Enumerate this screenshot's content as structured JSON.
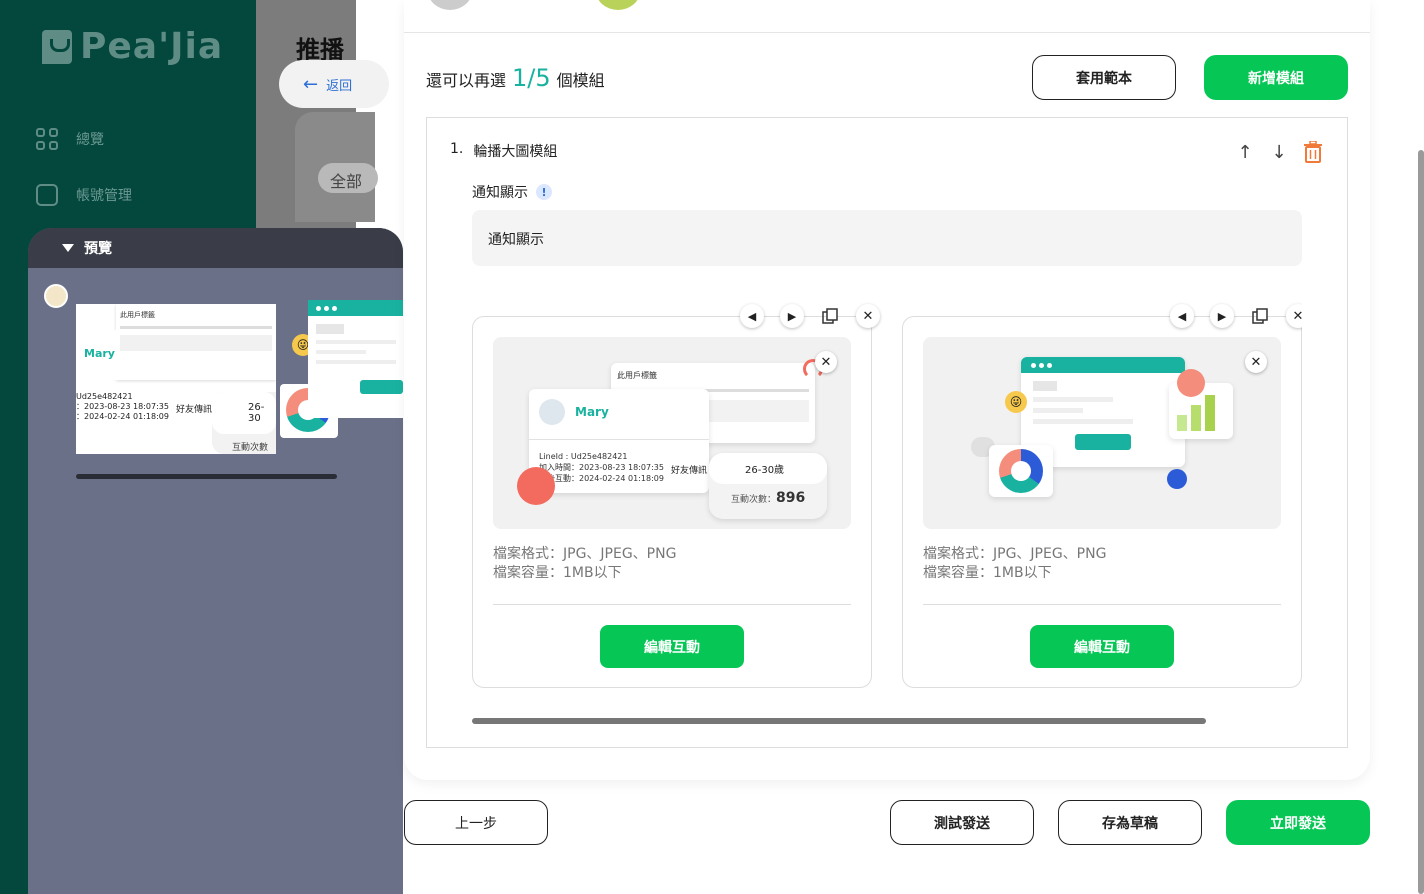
{
  "sidebar": {
    "brand": "Pea'Jia",
    "items": [
      {
        "label": "總覽",
        "icon": "grid-icon"
      },
      {
        "label": "帳號管理",
        "icon": "user-icon"
      }
    ]
  },
  "background_page": {
    "title": "推播",
    "back_label": "返回",
    "chip_label": "全部"
  },
  "preview": {
    "header_label": "預覽",
    "image": {
      "card_title": "此用戶標籤",
      "name": "Mary",
      "line_id": "Ud25e482421",
      "join_time": "：2023-08-23 18:07:35",
      "interact_time": "：2024-02-24 01:18:09",
      "friend_label": "好友傳訊",
      "age": "26-30",
      "interact_count_label": "互動次數"
    }
  },
  "editor": {
    "remain_prefix": "還可以再選",
    "remain_count": "1/5",
    "remain_suffix": "個模組",
    "apply_template_label": "套用範本",
    "add_module_label": "新增模組",
    "module": {
      "index": "1.",
      "title": "輪播大圖模組",
      "notify_label": "通知顯示",
      "notify_value": "通知顯示",
      "slides": [
        {
          "format": "檔案格式：JPG、JPEG、PNG",
          "size": "檔案容量：1MB以下",
          "edit_label": "編輯互動",
          "illustration": {
            "card_title": "此用戶標籤",
            "name": "Mary",
            "line_id": "LineId : Ud25e482421",
            "join_time": "加入時間：2023-08-23 18:07:35",
            "interact_time": "最後互動：2024-02-24 01:18:09",
            "friend_label": "好友傳訊",
            "age": "26-30歲",
            "interact_count_label": "互動次數：",
            "interact_count": "896"
          }
        },
        {
          "format": "檔案格式：JPG、JPEG、PNG",
          "size": "檔案容量：1MB以下",
          "edit_label": "編輯互動"
        }
      ]
    }
  },
  "footer": {
    "prev_label": "上一步",
    "test_label": "測試發送",
    "draft_label": "存為草稿",
    "send_label": "立即發送"
  },
  "colors": {
    "brand_green": "#06c755",
    "teal_accent": "#19b2a0",
    "sidebar_bg": "#03473d",
    "delete_orange": "#f07a3a"
  }
}
